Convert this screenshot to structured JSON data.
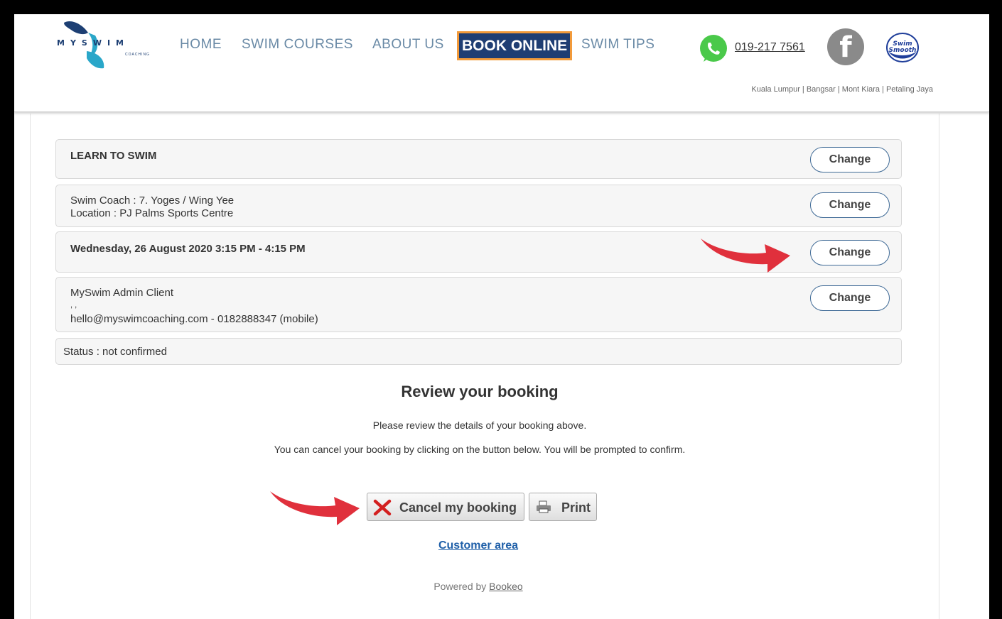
{
  "header": {
    "logo_text": "MYSWIM",
    "logo_sub": "COACHING",
    "nav": [
      "HOME",
      "SWIM COURSES",
      "ABOUT US",
      "BOOK ONLINE",
      "SWIM TIPS"
    ],
    "phone": "019-217 7561",
    "swim_smooth_text": "Swim Smooth",
    "locations": "Kuala Lumpur | Bangsar | Mont Kiara | Petaling Jaya"
  },
  "booking": {
    "course": "LEARN TO SWIM",
    "coach_line": "Swim Coach : 7. Yoges / Wing Yee",
    "location_line": "Location : PJ Palms Sports Centre",
    "datetime": "Wednesday, 26 August 2020 3:15 PM - 4:15 PM",
    "client_name": "MySwim Admin Client",
    "client_blank": ", ,",
    "client_contact": "hello@myswimcoaching.com - 0182888347 (mobile)",
    "status": "Status : not confirmed",
    "change_label": "Change"
  },
  "review": {
    "title": "Review your booking",
    "line1": "Please review the details of your booking above.",
    "line2": "You can cancel your booking by clicking on the button below. You will be prompted to confirm."
  },
  "actions": {
    "cancel_label": "Cancel my booking",
    "print_label": "Print",
    "customer_area": "Customer area",
    "powered_prefix": "Powered by",
    "powered_link": "Bookeo"
  },
  "colors": {
    "arrow": "#e0303c",
    "brand_navy": "#1f3e73",
    "brand_orange": "#f29a3a"
  }
}
